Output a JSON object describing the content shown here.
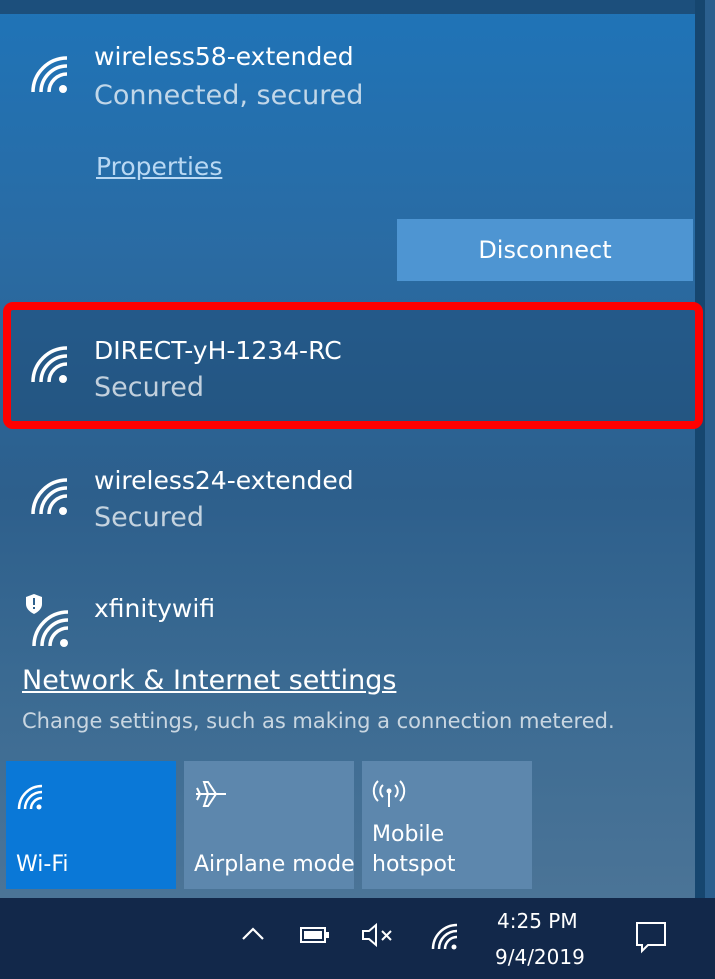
{
  "networks": [
    {
      "name": "wireless58-extended",
      "status": "Connected, secured",
      "icon": "wifi-icon"
    },
    {
      "name": "DIRECT-yH-1234-RC",
      "status": "Secured",
      "icon": "wifi-icon"
    },
    {
      "name": "wireless24-extended",
      "status": "Secured",
      "icon": "wifi-icon"
    },
    {
      "name": "xfinitywifi",
      "status": "",
      "icon": "wifi-shield-icon"
    }
  ],
  "connected": {
    "properties_label": "Properties",
    "disconnect_label": "Disconnect"
  },
  "settings": {
    "link_label": "Network & Internet settings",
    "description": "Change settings, such as making a connection metered."
  },
  "quick_actions": [
    {
      "label": "Wi-Fi",
      "icon": "wifi-icon",
      "active": true
    },
    {
      "label": "Airplane mode",
      "icon": "airplane-icon",
      "active": false
    },
    {
      "label_line1": "Mobile",
      "label_line2": "hotspot",
      "icon": "hotspot-icon",
      "active": false
    }
  ],
  "taskbar": {
    "time": "4:25 PM",
    "date": "9/4/2019",
    "icons": [
      "chevron-up-icon",
      "battery-icon",
      "volume-muted-icon",
      "wifi-icon",
      "notification-icon"
    ]
  },
  "colors": {
    "accent": "#0a78d7",
    "highlight_border": "#ff0000",
    "taskbar": "#12284a"
  }
}
